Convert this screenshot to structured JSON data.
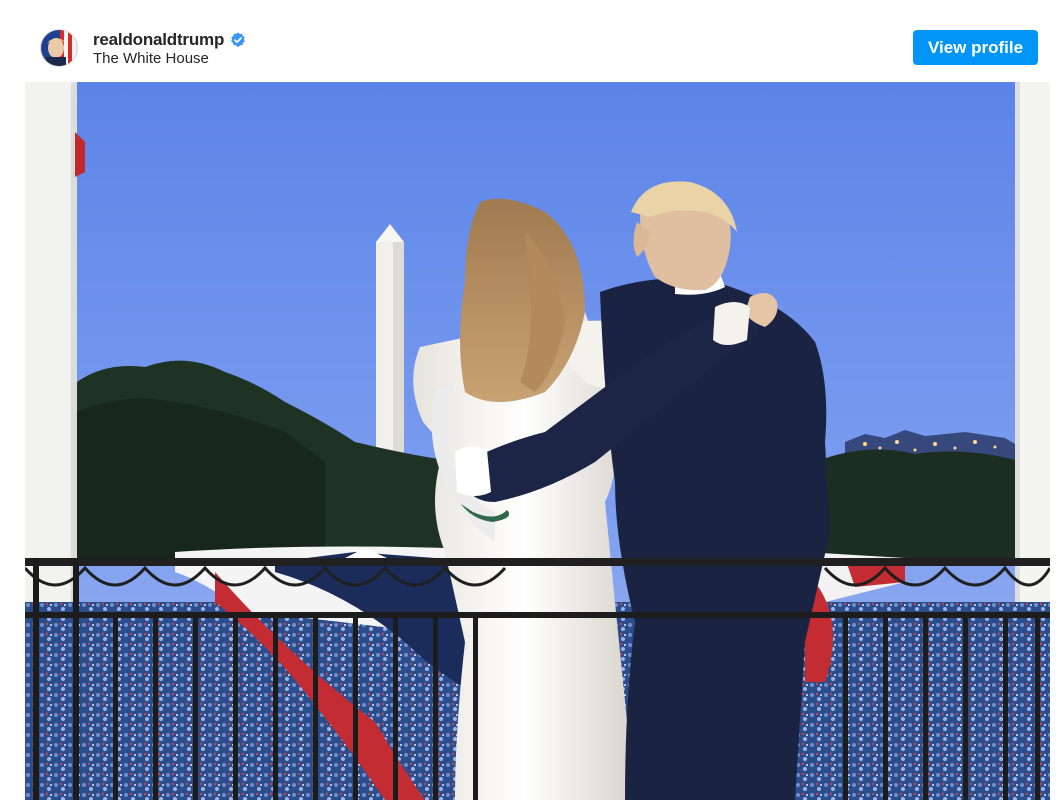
{
  "post": {
    "username": "realdonaldtrump",
    "verified": true,
    "location": "The White House",
    "view_profile_label": "View profile"
  },
  "icons": {
    "avatar": "flag-portrait-avatar",
    "verified": "verified-badge-icon"
  },
  "photo": {
    "subject": "couple-embracing-on-white-house-balcony",
    "colors": {
      "sky": "#5c84e8",
      "brand_button": "#0095f6"
    }
  }
}
